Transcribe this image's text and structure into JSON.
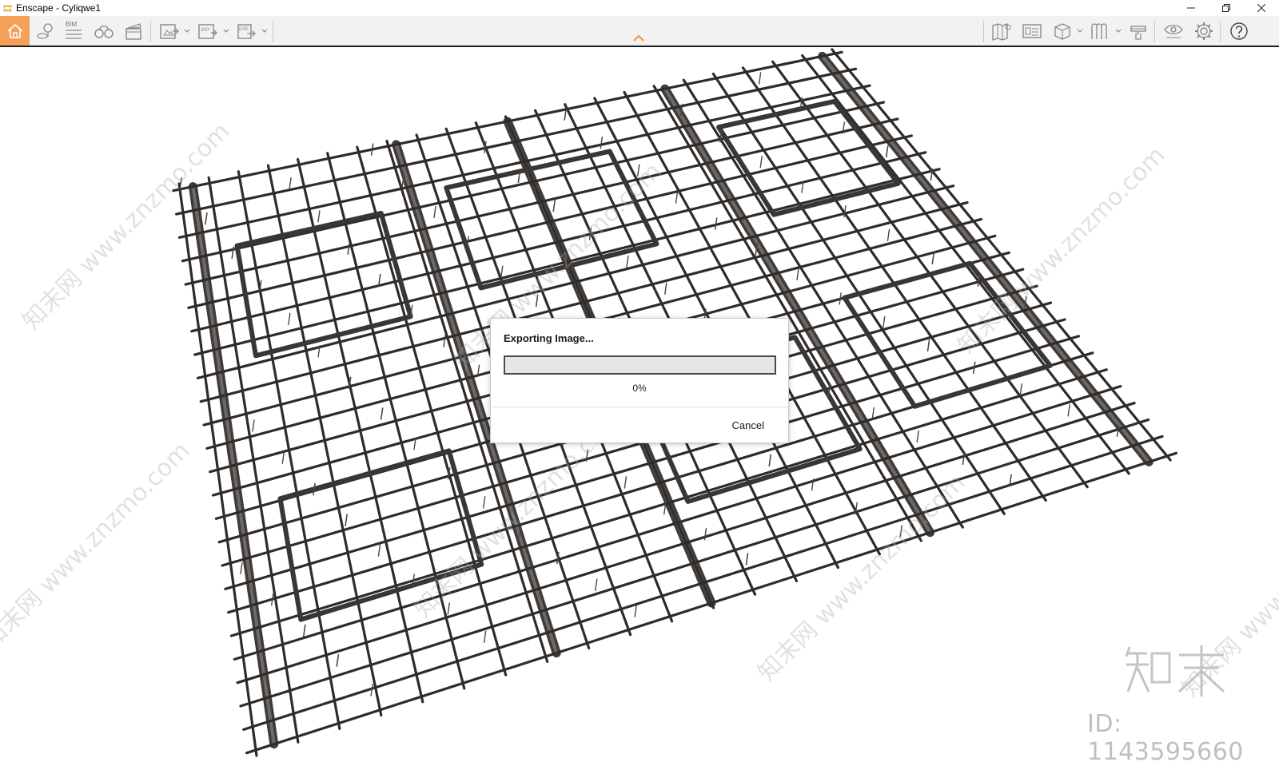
{
  "window": {
    "title": "Enscape - Cyliqwe1",
    "controls": [
      "minimize",
      "restore",
      "close"
    ]
  },
  "toolbar": {
    "left_tools": [
      {
        "icon": "home-icon",
        "active": true
      },
      {
        "icon": "map-pin-icon"
      },
      {
        "icon": "bim-icon",
        "label": "BIM"
      },
      {
        "icon": "binoculars-icon"
      },
      {
        "icon": "clapperboard-icon"
      },
      {
        "icon": "screenshot-export-icon",
        "dropdown": true
      },
      {
        "icon": "panorama-360-icon",
        "label": "360°",
        "dropdown": true
      },
      {
        "icon": "exe-export-icon",
        "label": "EXE",
        "dropdown": true
      }
    ],
    "right_tools": [
      {
        "icon": "map-icon"
      },
      {
        "icon": "asset-library-icon"
      },
      {
        "icon": "cube-view-icon",
        "dropdown": true
      },
      {
        "icon": "views-icon",
        "dropdown": true
      },
      {
        "icon": "material-editor-icon"
      },
      {
        "icon": "visual-settings-icon"
      },
      {
        "icon": "settings-gear-icon"
      },
      {
        "icon": "help-icon"
      }
    ],
    "accent_color": "#f5a15a"
  },
  "viewport": {
    "watermark_text": "知末网 www.znzmo.com",
    "brand_logo": "知末",
    "id_text": "ID: 1143595660"
  },
  "dialog": {
    "title": "Exporting Image...",
    "progress": 0,
    "progress_text": "0%",
    "cancel_label": "Cancel"
  }
}
